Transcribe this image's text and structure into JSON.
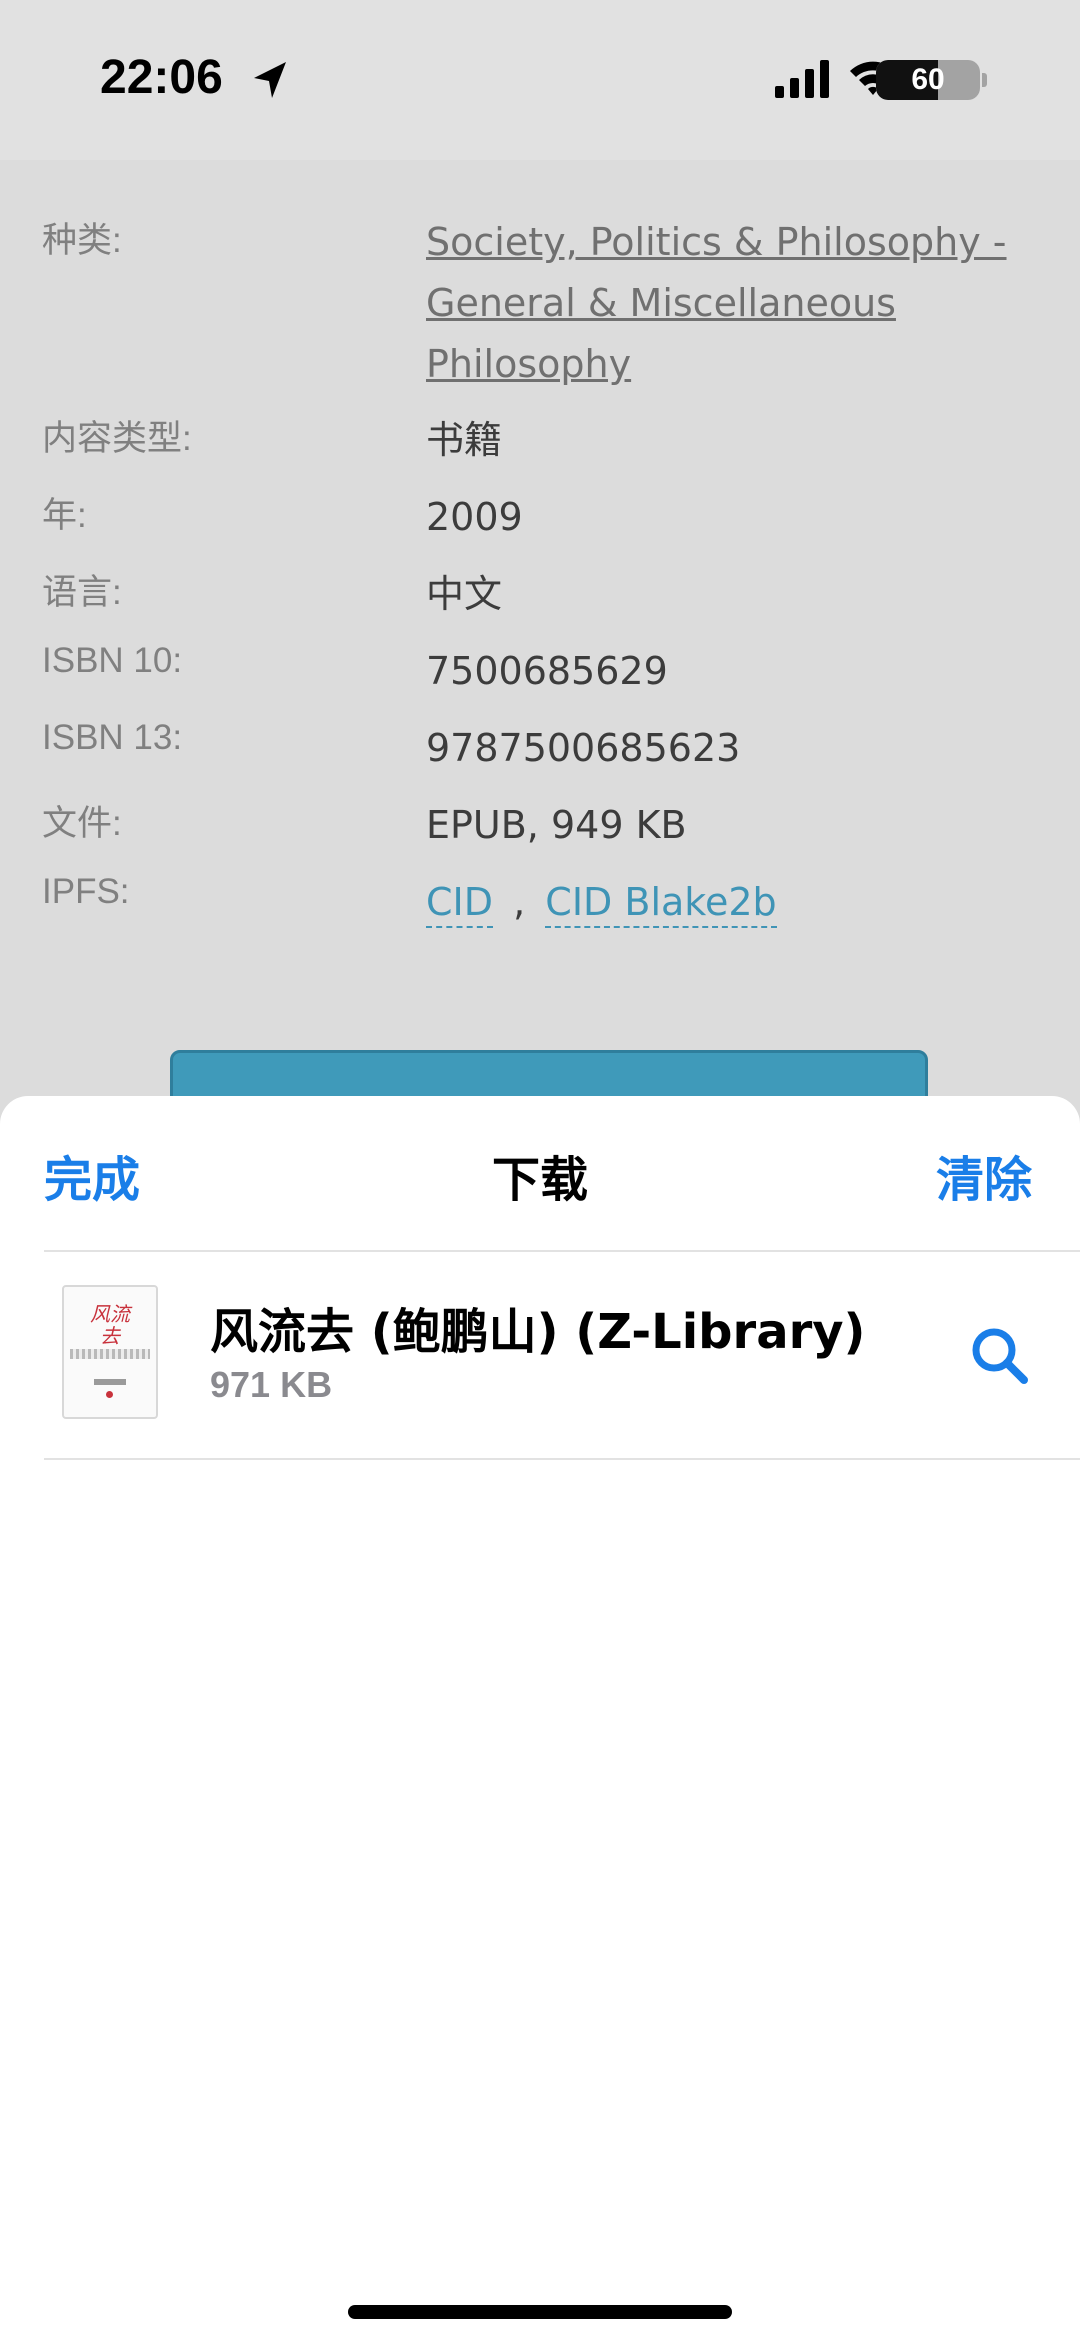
{
  "status_bar": {
    "time": "22:06",
    "battery_level": "60",
    "battery_fraction": 0.6,
    "icons": [
      "location-arrow-icon",
      "signal-icon",
      "wifi-icon",
      "battery-icon"
    ]
  },
  "book_details": {
    "rows": [
      {
        "key": "种类:",
        "value": "Society, Politics & Philosophy - General & Miscellaneous Philosophy",
        "is_link": true
      },
      {
        "key": "内容类型:",
        "value": "书籍"
      },
      {
        "key": "年:",
        "value": "2009"
      },
      {
        "key": "语言:",
        "value": "中文"
      },
      {
        "key": "ISBN 10:",
        "value": "7500685629"
      },
      {
        "key": "ISBN 13:",
        "value": "9787500685623"
      },
      {
        "key": "文件:",
        "value": "EPUB, 949 KB"
      },
      {
        "key": "IPFS:",
        "links": [
          "CID",
          "CID Blake2b"
        ],
        "separator": ","
      }
    ]
  },
  "downloads_sheet": {
    "done_label": "完成",
    "title": "下载",
    "clear_label": "清除",
    "items": [
      {
        "name": "风流去 (鲍鹏山) (Z-Library)",
        "size": "971 KB",
        "thumbnail_title": "风流去",
        "action_icon": "magnifying-glass-icon"
      }
    ]
  },
  "colors": {
    "accent": "#1a7ee8",
    "link_teal": "#3f94b6",
    "dim_background": "#dcdcdc",
    "secondary_text": "#8a8a8f"
  }
}
